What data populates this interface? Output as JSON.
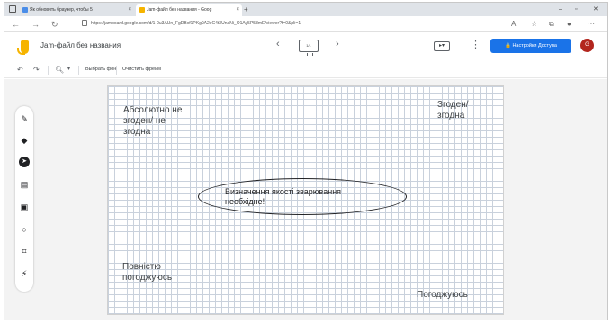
{
  "browser": {
    "tabs": [
      {
        "label": "Як обновить браузер, чтобы 5",
        "active": false
      },
      {
        "label": "Jam-файл без названия - Goog",
        "active": true
      }
    ],
    "new_tab": "+",
    "url": "https://jamboard.google.com/d/1-0u3AUn_FgDBxf1PKg0A2eC4t3UnaNi_O1Ay5P53mE/viewer?f=0&pli=1"
  },
  "app": {
    "doc_title": "Jam-файл без названия",
    "frame_counter": "1/1",
    "share_label": "Настройки Доступа",
    "avatar_letter": "G",
    "accent_color": "#1a73e8",
    "avatar_color": "#b3261e"
  },
  "toolbar": {
    "set_background": "Выбрать фон",
    "clear_frame": "Очистить фрейм"
  },
  "tools": [
    "pen-icon",
    "eraser-icon",
    "select-icon",
    "sticky-note-icon",
    "image-icon",
    "circle-icon",
    "text-box-icon",
    "laser-icon"
  ],
  "board": {
    "top_left": [
      "Абсолютно не",
      "згоден/ не",
      "згодна"
    ],
    "top_right": [
      "Згоден/",
      "згодна"
    ],
    "center": [
      "Визначення якості зварювання",
      "необхідне!"
    ],
    "bottom_left": [
      "Повністю",
      "погоджуюсь"
    ],
    "bottom_right": "Погоджуюсь"
  }
}
